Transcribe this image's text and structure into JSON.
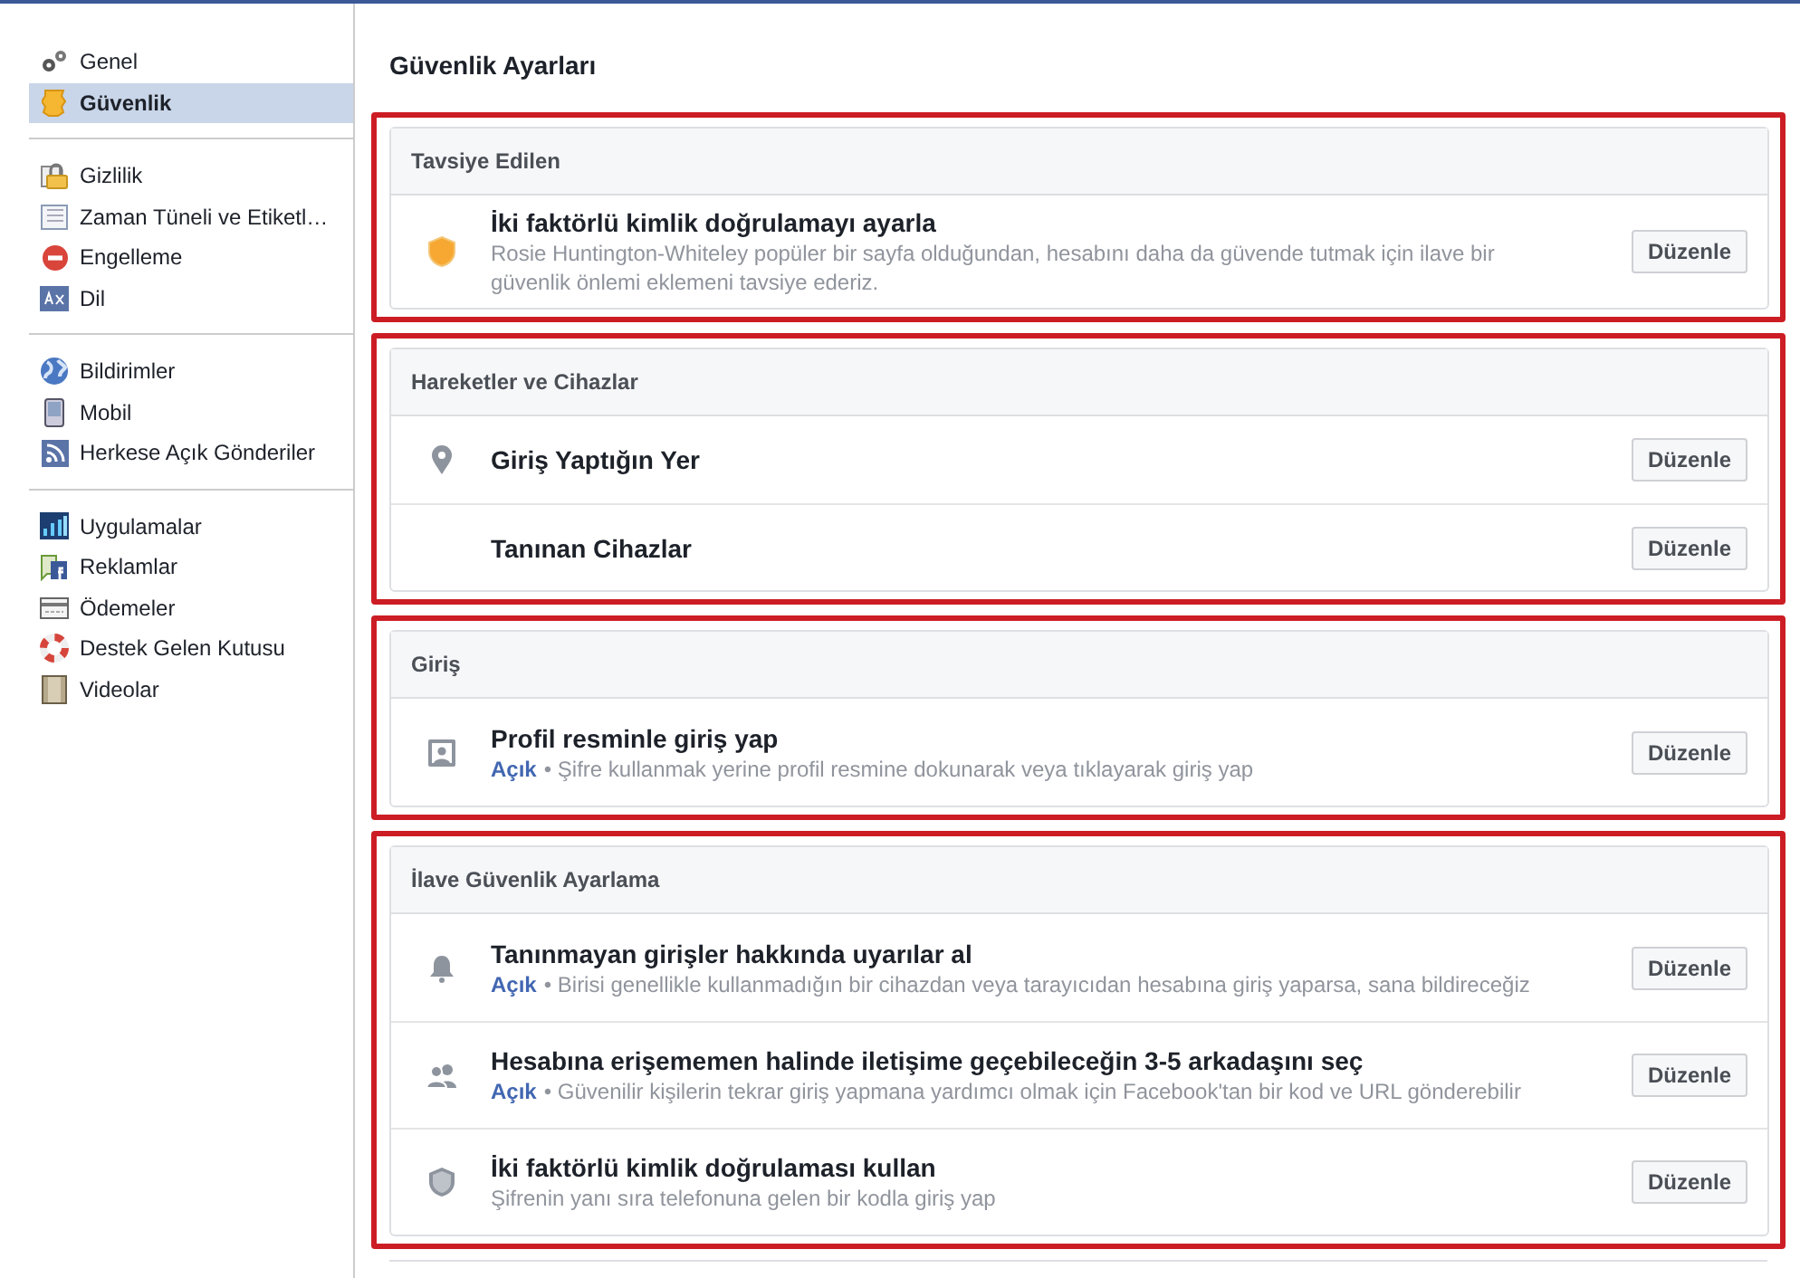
{
  "sidebar": {
    "groups": [
      {
        "items": [
          {
            "label": "Genel",
            "selected": false
          },
          {
            "label": "Güvenlik",
            "selected": true
          }
        ]
      },
      {
        "items": [
          {
            "label": "Gizlilik",
            "selected": false
          },
          {
            "label": "Zaman Tüneli ve Etiketl…",
            "selected": false
          },
          {
            "label": "Engelleme",
            "selected": false
          },
          {
            "label": "Dil",
            "selected": false
          }
        ]
      },
      {
        "items": [
          {
            "label": "Bildirimler",
            "selected": false
          },
          {
            "label": "Mobil",
            "selected": false
          },
          {
            "label": "Herkese Açık Gönderiler",
            "selected": false
          }
        ]
      },
      {
        "items": [
          {
            "label": "Uygulamalar",
            "selected": false
          },
          {
            "label": "Reklamlar",
            "selected": false
          },
          {
            "label": "Ödemeler",
            "selected": false
          },
          {
            "label": "Destek Gelen Kutusu",
            "selected": false
          },
          {
            "label": "Videolar",
            "selected": false
          }
        ]
      }
    ]
  },
  "page_title": "Güvenlik Ayarları",
  "sections": [
    {
      "title": "Tavsiye Edilen",
      "highlighted": true,
      "rows": [
        {
          "title": "İki faktörlü kimlik doğrulamayı ayarla",
          "description": "Rosie Huntington-Whiteley popüler bir sayfa olduğundan, hesabını daha da güvende tutmak için ilave bir güvenlik önlemi eklemeni tavsiye ederiz.",
          "button": "Düzenle"
        }
      ]
    },
    {
      "title": "Hareketler ve Cihazlar",
      "highlighted": true,
      "rows": [
        {
          "title": "Giriş Yaptığın Yer",
          "button": "Düzenle"
        },
        {
          "title": "Tanınan Cihazlar",
          "button": "Düzenle"
        }
      ]
    },
    {
      "title": "Giriş",
      "highlighted": true,
      "rows": [
        {
          "title": "Profil resminle giriş yap",
          "status": "Açık",
          "description": "• Şifre kullanmak yerine profil resmine dokunarak veya tıklayarak giriş yap",
          "button": "Düzenle"
        }
      ]
    },
    {
      "title": "İlave Güvenlik Ayarlama",
      "highlighted": true,
      "rows": [
        {
          "title": "Tanınmayan girişler hakkında uyarılar al",
          "status": "Açık",
          "description": "• Birisi genellikle kullanmadığın bir cihazdan veya tarayıcıdan hesabına giriş yaparsa, sana bildireceğiz",
          "button": "Düzenle"
        },
        {
          "title": "Hesabına erişememen halinde iletişime geçebileceğin 3-5 arkadaşını seç",
          "status": "Açık",
          "description": "• Güvenilir kişilerin tekrar giriş yapmana yardımcı olmak için Facebook'tan bir kod ve URL gönderebilir",
          "button": "Düzenle"
        },
        {
          "title": "İki faktörlü kimlik doğrulaması kullan",
          "description": "Şifrenin yanı sıra telefonuna gelen bir kodla giriş yap",
          "button": "Düzenle"
        }
      ]
    }
  ]
}
